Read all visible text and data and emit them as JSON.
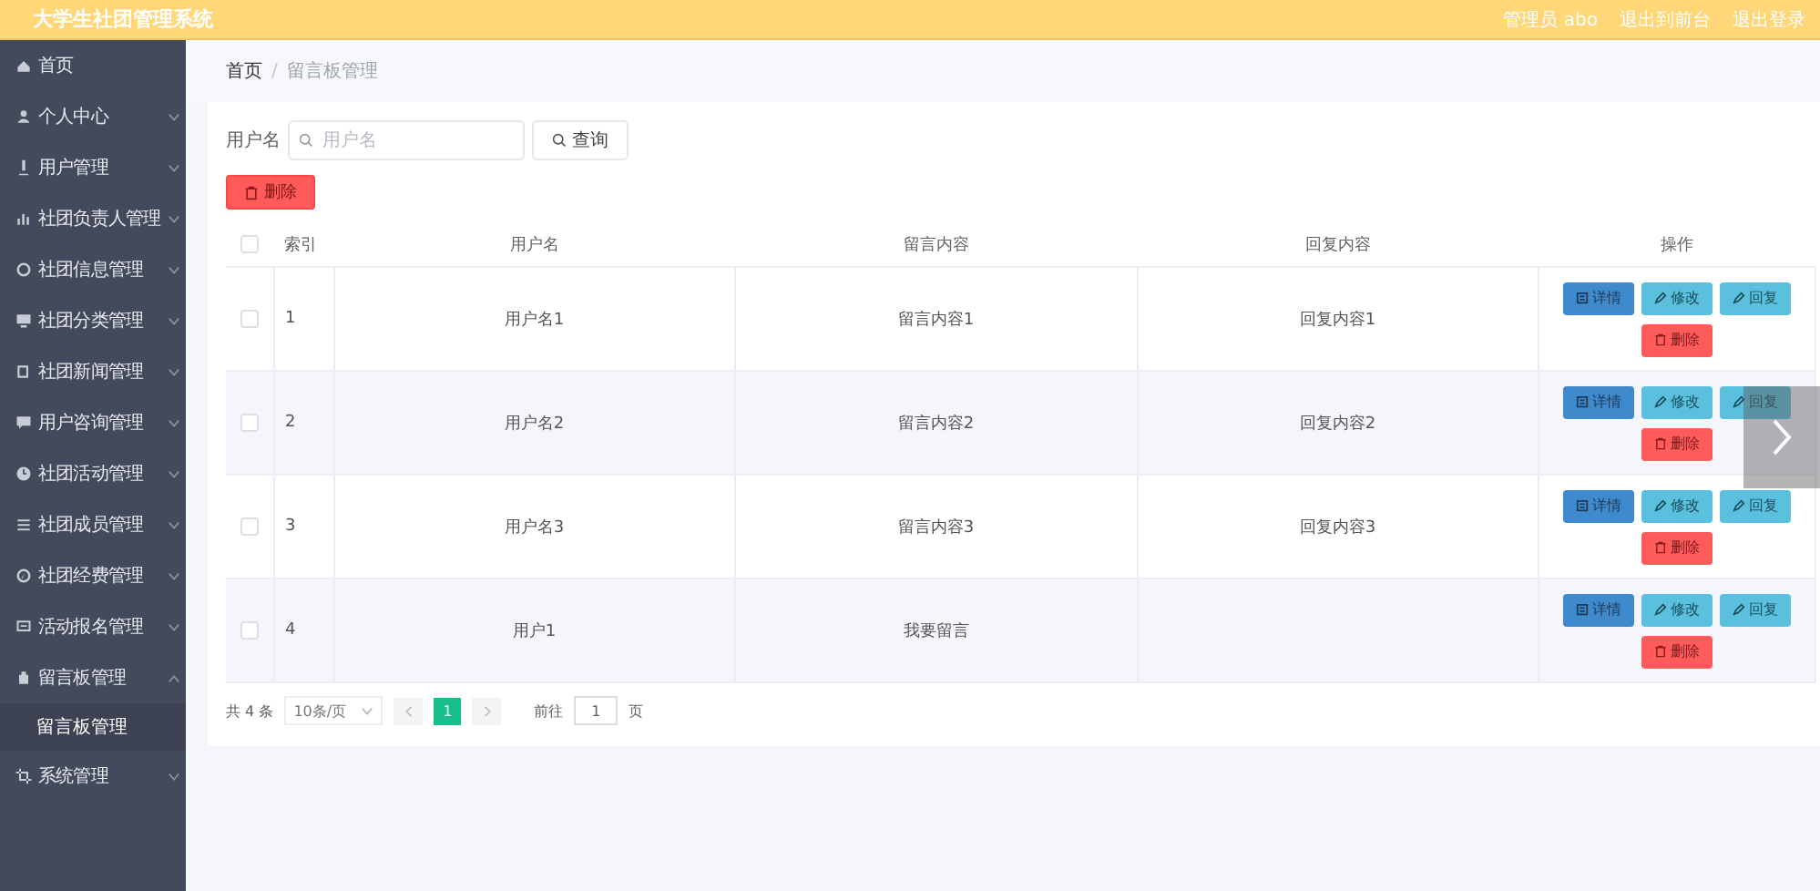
{
  "header": {
    "title": "大学生社团管理系统",
    "links": [
      "管理员 abo",
      "退出到前台",
      "退出登录"
    ]
  },
  "sidebar": {
    "items": [
      {
        "label": "首页"
      },
      {
        "label": "个人中心",
        "expanded": false
      },
      {
        "label": "用户管理",
        "expanded": false
      },
      {
        "label": "社团负责人管理",
        "expanded": false
      },
      {
        "label": "社团信息管理",
        "expanded": false
      },
      {
        "label": "社团分类管理",
        "expanded": false
      },
      {
        "label": "社团新闻管理",
        "expanded": false
      },
      {
        "label": "用户咨询管理",
        "expanded": false
      },
      {
        "label": "社团活动管理",
        "expanded": false
      },
      {
        "label": "社团成员管理",
        "expanded": false
      },
      {
        "label": "社团经费管理",
        "expanded": false
      },
      {
        "label": "活动报名管理",
        "expanded": false
      },
      {
        "label": "留言板管理",
        "expanded": true,
        "children": [
          {
            "label": "留言板管理",
            "selected": true
          }
        ]
      },
      {
        "label": "系统管理",
        "expanded": false
      }
    ]
  },
  "breadcrumb": {
    "items": [
      "首页",
      "留言板管理"
    ],
    "separators": [
      "/"
    ]
  },
  "search": {
    "label": "用户名",
    "placeholder": "用户名",
    "button": "查询"
  },
  "delete_button": "删除",
  "table": {
    "select_all_checked": false,
    "columns": [
      "索引",
      "用户名",
      "留言内容",
      "回复内容",
      "操作"
    ],
    "rows": [
      {
        "checked": false,
        "cells": [
          "1",
          "用户名1",
          "留言内容1",
          "回复内容1"
        ],
        "actions": [
          {
            "kind": "detail",
            "label": "详情"
          },
          {
            "kind": "edit",
            "label": "修改"
          },
          {
            "kind": "reply",
            "label": "回复"
          },
          {
            "kind": "delete",
            "label": "删除"
          }
        ]
      },
      {
        "checked": false,
        "cells": [
          "2",
          "用户名2",
          "留言内容2",
          "回复内容2"
        ],
        "actions": [
          {
            "kind": "detail",
            "label": "详情"
          },
          {
            "kind": "edit",
            "label": "修改"
          },
          {
            "kind": "reply",
            "label": "回复"
          },
          {
            "kind": "delete",
            "label": "删除"
          }
        ]
      },
      {
        "checked": false,
        "cells": [
          "3",
          "用户名3",
          "留言内容3",
          "回复内容3"
        ],
        "actions": [
          {
            "kind": "detail",
            "label": "详情"
          },
          {
            "kind": "edit",
            "label": "修改"
          },
          {
            "kind": "reply",
            "label": "回复"
          },
          {
            "kind": "delete",
            "label": "删除"
          }
        ]
      },
      {
        "checked": false,
        "cells": [
          "4",
          "用户1",
          "我要留言",
          ""
        ],
        "actions": [
          {
            "kind": "detail",
            "label": "详情"
          },
          {
            "kind": "edit",
            "label": "修改"
          },
          {
            "kind": "reply",
            "label": "回复"
          },
          {
            "kind": "delete",
            "label": "删除"
          }
        ]
      }
    ]
  },
  "pagination": {
    "total": "共 4 条",
    "page_size": "10条/页",
    "pages": [
      {
        "label": "1",
        "selected": true
      }
    ],
    "goto_label": "前往",
    "goto_value": "1",
    "goto_suffix": "页"
  }
}
